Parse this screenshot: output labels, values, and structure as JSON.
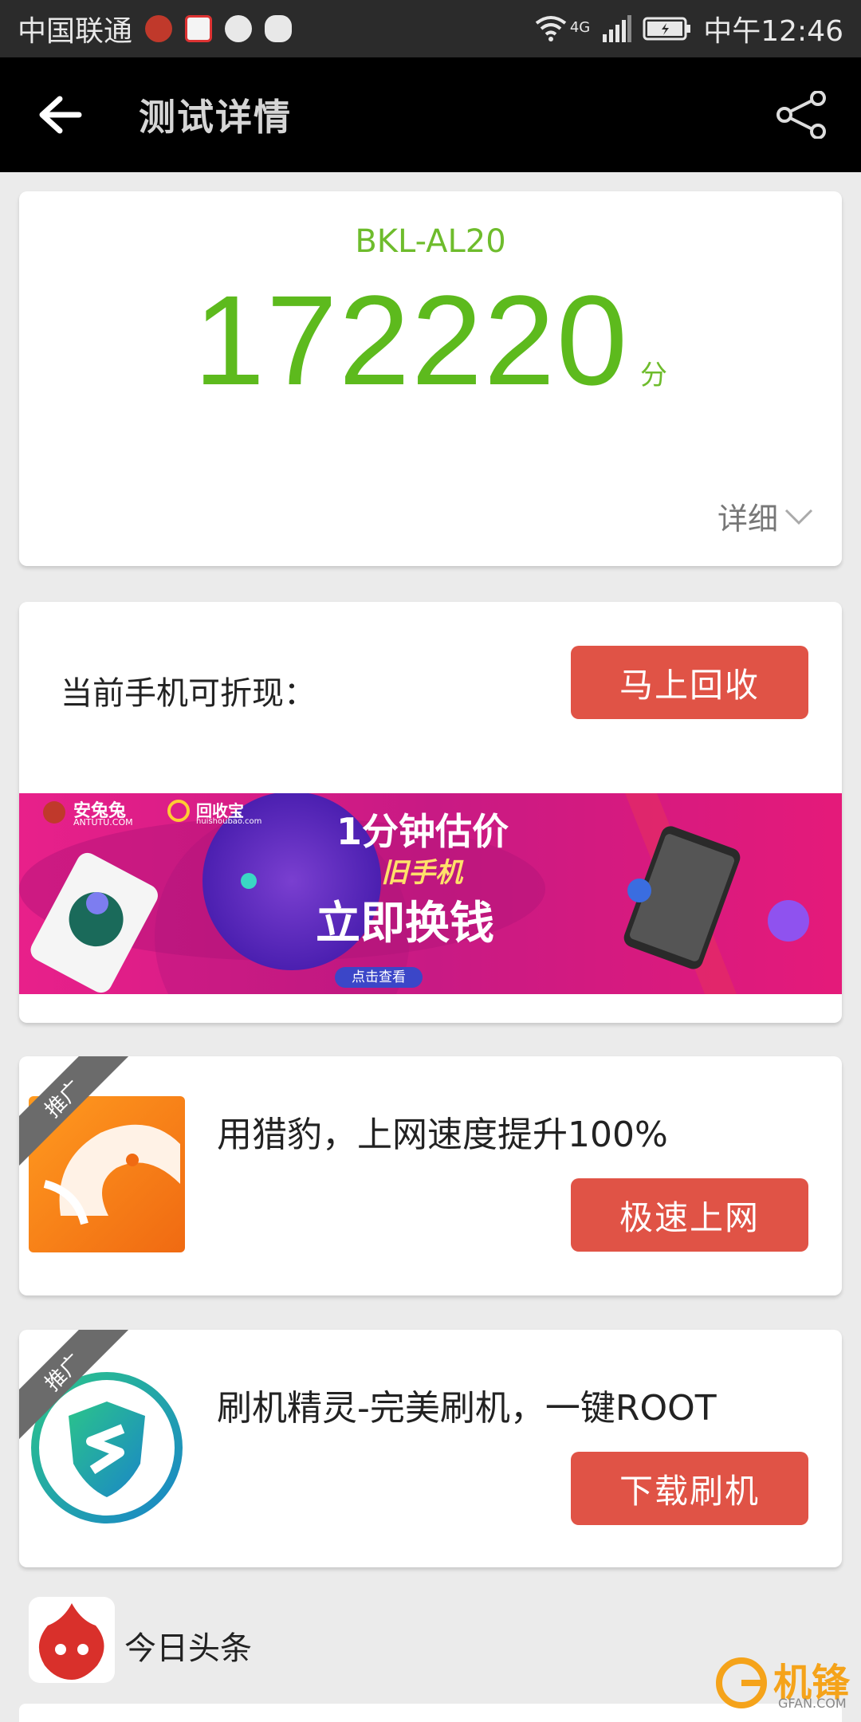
{
  "status_bar": {
    "carrier": "中国联通",
    "network": "4G",
    "time": "中午12:46"
  },
  "app_bar": {
    "title": "测试详情"
  },
  "score_card": {
    "device": "BKL-AL20",
    "score": "172220",
    "unit": "分",
    "detail_label": "详细"
  },
  "recycle": {
    "label": "当前手机可折现：",
    "button": "马上回收",
    "banner": {
      "brand1": "安兔兔",
      "brand1_sub": "ANTUTU.COM",
      "brand2": "回收宝",
      "brand2_sub": "huishoubao.com",
      "line1": "1分钟估价",
      "line2": "旧手机",
      "line3": "立即换钱",
      "cta": "点击查看"
    }
  },
  "ads": [
    {
      "badge": "推广",
      "text": "用猎豹，上网速度提升100%",
      "button": "极速上网"
    },
    {
      "badge": "推广",
      "text": "刷机精灵-完美刷机，一键ROOT",
      "button": "下载刷机"
    }
  ],
  "news": {
    "label": "今日头条"
  },
  "watermark": {
    "text": "机锋",
    "sub": "GFAN.COM"
  },
  "colors": {
    "accent_green": "#5dba1d",
    "button_red": "#e05346",
    "app_bar_bg": "#000000"
  }
}
